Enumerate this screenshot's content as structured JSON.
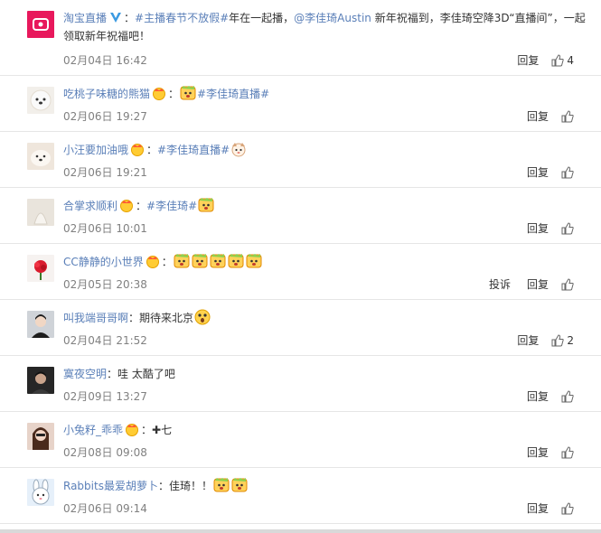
{
  "comments": [
    {
      "user": "淘宝直播",
      "verified": true,
      "segments": [
        {
          "t": "：",
          "c": "plain"
        },
        {
          "t": "#主播春节不放假#",
          "c": "topic"
        },
        {
          "t": "年在一起播，",
          "c": "plain"
        },
        {
          "t": "@李佳琦Austin",
          "c": "link"
        },
        {
          "t": " 新年祝福到，李佳琦空降3D“直播间”，一起领取新年祝福吧！",
          "c": "plain"
        }
      ],
      "time": "02月04日 16:42",
      "reply": "回复",
      "like_count": "4"
    },
    {
      "user": "吃桃子味糖的熊猫",
      "segments": [
        {
          "t": "：",
          "c": "plain"
        },
        {
          "t": "#李佳琦直播#",
          "c": "topic"
        }
      ],
      "time": "02月06日 19:27",
      "reply": "回复"
    },
    {
      "user": "小汪要加油哦",
      "segments": [
        {
          "t": "：",
          "c": "plain"
        },
        {
          "t": "#李佳琦直播#",
          "c": "topic"
        }
      ],
      "time": "02月06日 19:21",
      "reply": "回复"
    },
    {
      "user": "合掌求顺利",
      "segments": [
        {
          "t": "：",
          "c": "plain"
        },
        {
          "t": "#李佳琦#",
          "c": "topic"
        }
      ],
      "time": "02月06日 10:01",
      "reply": "回复"
    },
    {
      "user": "CC静静的小世界",
      "segments": [
        {
          "t": "：",
          "c": "plain"
        }
      ],
      "time": "02月05日 20:38",
      "report": "投诉",
      "reply": "回复"
    },
    {
      "user": "叫我端哥哥啊",
      "segments": [
        {
          "t": "：期待来北京",
          "c": "plain"
        }
      ],
      "time": "02月04日 21:52",
      "reply": "回复",
      "like_count": "2"
    },
    {
      "user": "寞夜空明",
      "segments": [
        {
          "t": "：哇 太酷了吧",
          "c": "plain"
        }
      ],
      "time": "02月09日 13:27",
      "reply": "回复"
    },
    {
      "user": "小兔籽_乖乖",
      "segments": [
        {
          "t": "：✚七",
          "c": "plain"
        }
      ],
      "time": "02月08日 09:08",
      "reply": "回复"
    },
    {
      "user": "Rabbits最爱胡萝卜",
      "segments": [
        {
          "t": "：佳琦！！",
          "c": "plain"
        }
      ],
      "time": "02月06日 09:14",
      "reply": "回复"
    }
  ],
  "icons": {
    "verified": "verified-v-icon",
    "like": "thumbs-up-icon",
    "crown": "crown-badge-icon",
    "emoji": "emoji-icon"
  },
  "colors": {
    "username": "#eb7350",
    "topic": "#5a7fb8",
    "time": "#808080",
    "divider": "#e6e6e6"
  }
}
